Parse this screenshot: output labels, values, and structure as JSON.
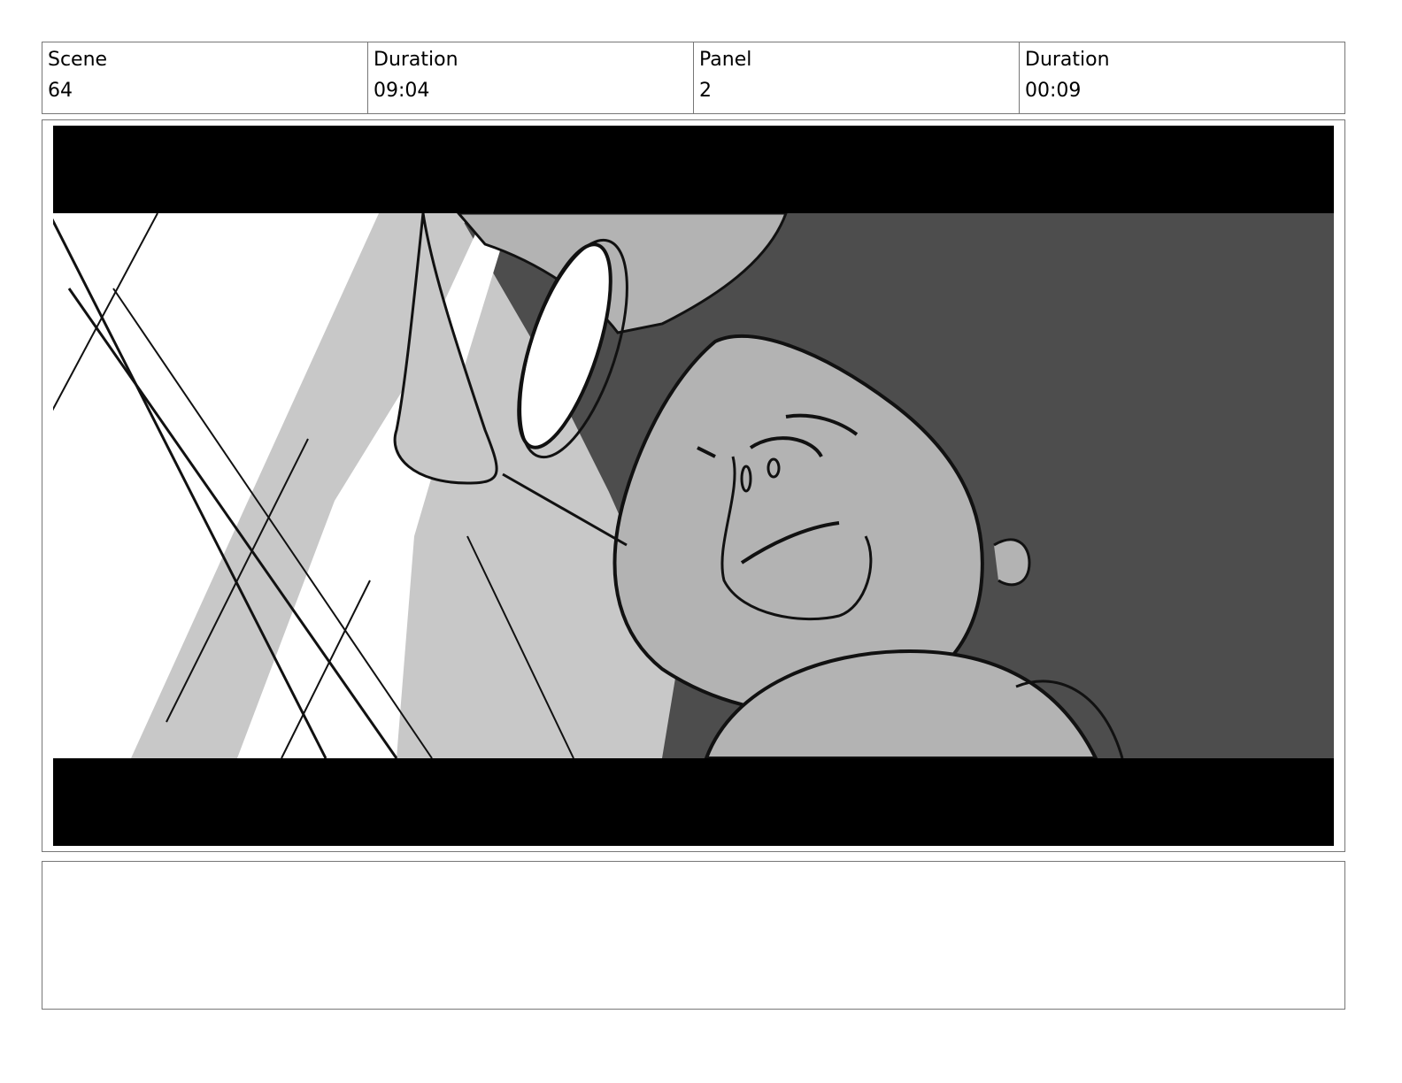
{
  "header": {
    "scene_label": "Scene",
    "scene_value": "64",
    "scene_duration_label": "Duration",
    "scene_duration_value": "09:04",
    "panel_label": "Panel",
    "panel_value": "2",
    "panel_duration_label": "Duration",
    "panel_duration_value": "00:09"
  },
  "notes": {
    "text": ""
  },
  "colors": {
    "border": "#777777",
    "letterbox": "#000000",
    "background_dark": "#4d4d4d",
    "midtone": "#b3b3b3",
    "light": "#c8c8c8"
  }
}
